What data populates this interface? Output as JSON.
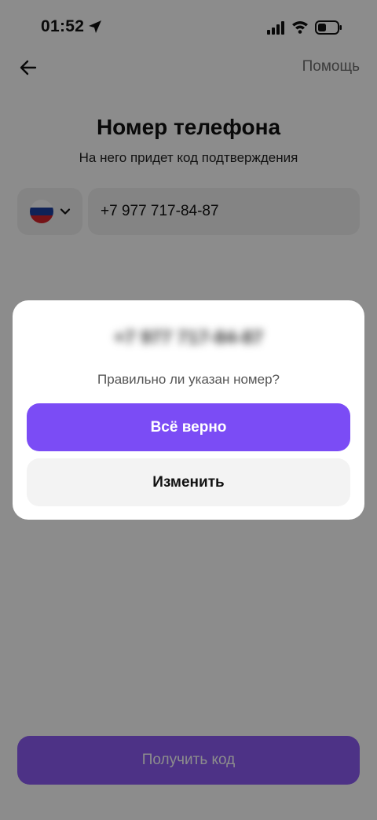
{
  "status_bar": {
    "time": "01:52",
    "icons": [
      "location-arrow-icon",
      "signal-icon",
      "wifi-icon",
      "battery-icon"
    ]
  },
  "header": {
    "back_icon": "arrow-left-icon",
    "help_label": "Помощь"
  },
  "main": {
    "title": "Номер телефона",
    "subtitle": "На него придет код подтверждения",
    "country": {
      "flag": "russia-flag-icon",
      "chevron": "chevron-down-icon"
    },
    "phone_value": "+7 977 717-84-87",
    "get_code_label": "Получить код"
  },
  "dialog": {
    "phone_blurred": "+7 977 717-84-87",
    "question": "Правильно ли указан номер?",
    "confirm_label": "Всё верно",
    "change_label": "Изменить"
  },
  "colors": {
    "accent": "#7b4cf5",
    "overlay": "rgba(0,0,0,0.45)",
    "field_bg": "#f1f1f1"
  }
}
